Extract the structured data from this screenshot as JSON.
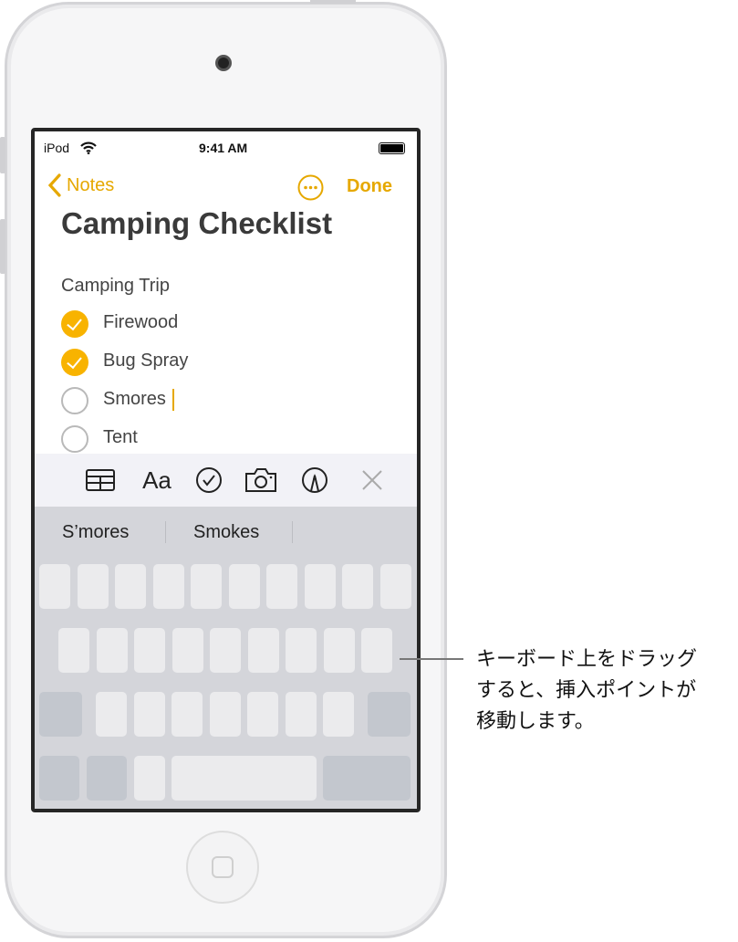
{
  "status_bar": {
    "carrier": "iPod",
    "time": "9:41 AM"
  },
  "nav": {
    "back_label": "Notes",
    "more_icon": "ellipsis-circle-icon",
    "done_label": "Done"
  },
  "note": {
    "title": "Camping Checklist",
    "heading": "Camping Trip",
    "items": [
      {
        "label": "Firewood",
        "checked": true
      },
      {
        "label": "Bug Spray",
        "checked": true
      },
      {
        "label": "Smores",
        "checked": false
      },
      {
        "label": "Tent",
        "checked": false
      }
    ]
  },
  "toolbar": {
    "icons": [
      "table-icon",
      "text-format-icon",
      "checklist-icon",
      "camera-icon",
      "markup-icon",
      "close-icon"
    ],
    "format_label": "Aa"
  },
  "keyboard": {
    "suggestions": [
      "S’mores",
      "Smokes",
      ""
    ]
  },
  "callout": {
    "lines": [
      "キーボード上をドラッグ",
      "すると、挿入ポイントが",
      "移動します。"
    ]
  },
  "colors": {
    "accent": "#E6A800",
    "check_fill": "#F8B300",
    "keyboard_bg": "#D4D5DA"
  }
}
